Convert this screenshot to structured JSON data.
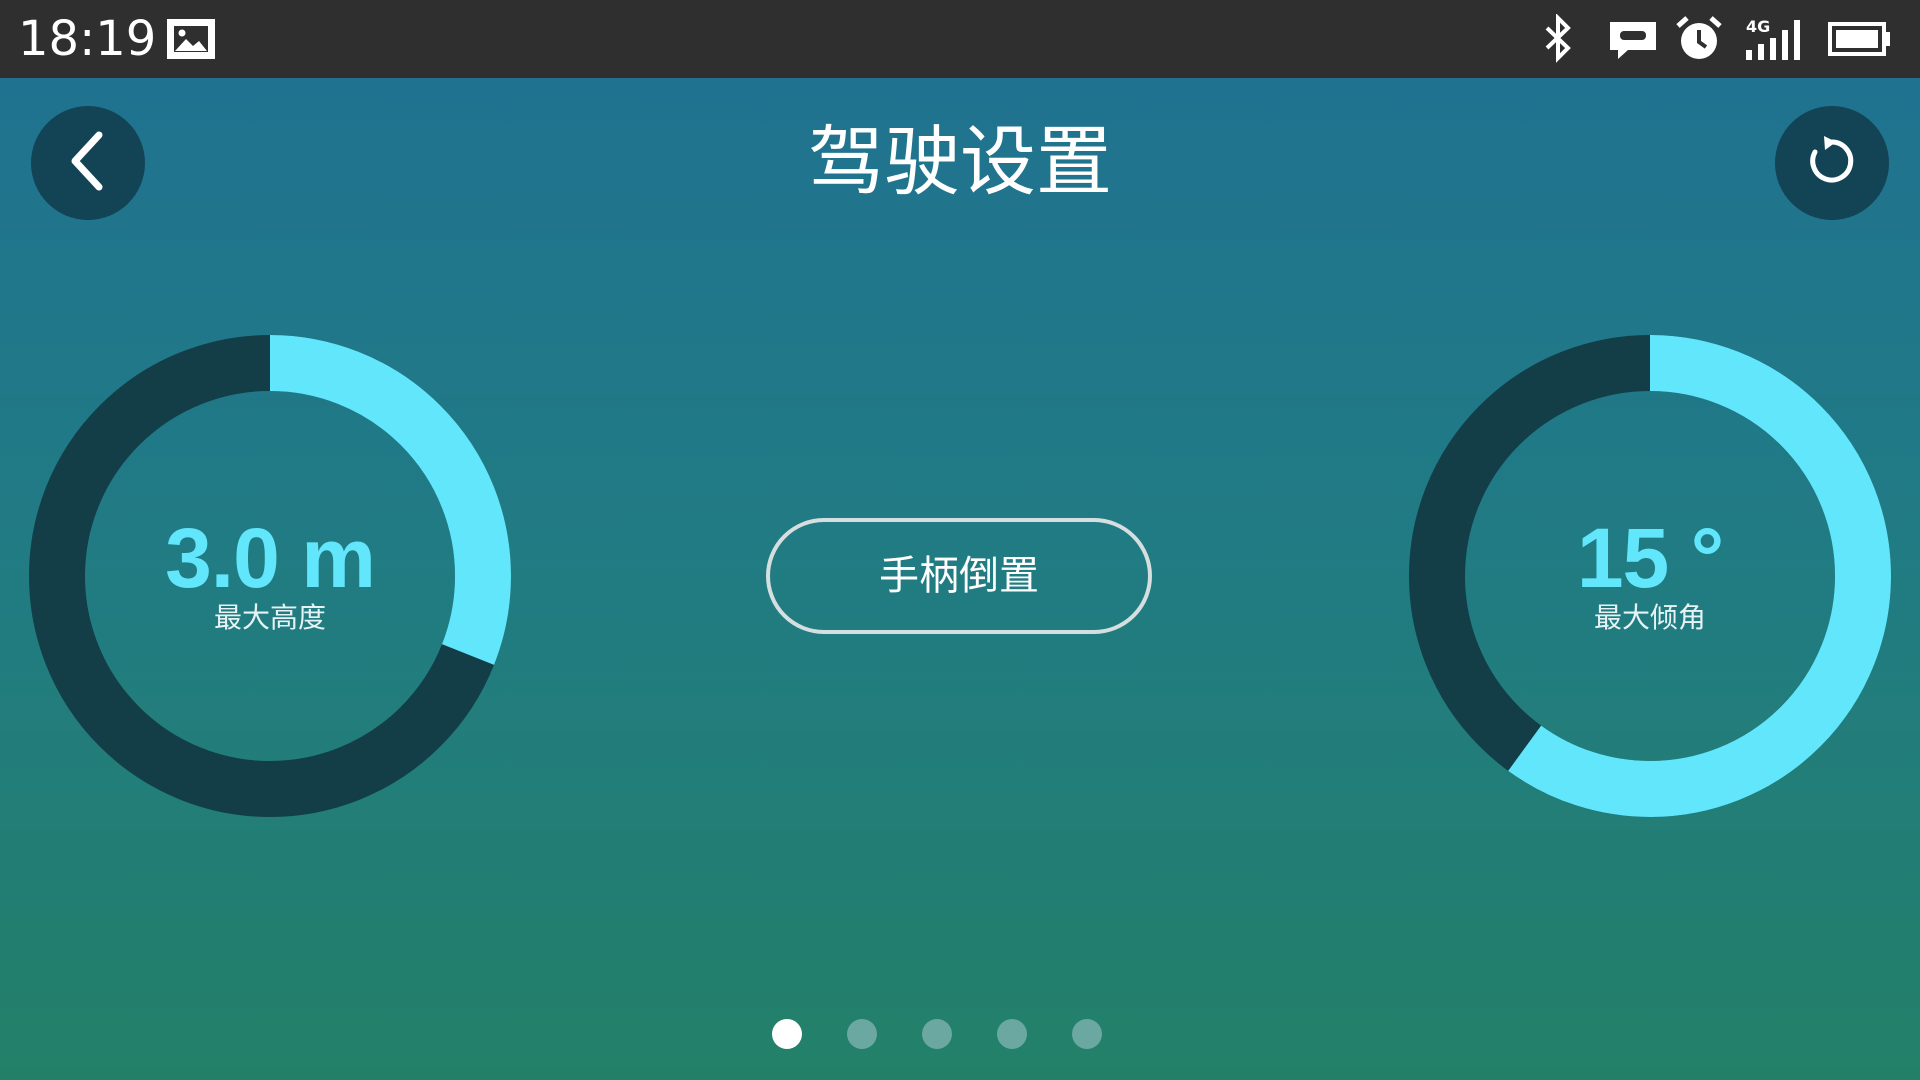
{
  "status_bar": {
    "time": "18:19",
    "icons": [
      "image-icon",
      "bluetooth-icon",
      "message-icon",
      "alarm-icon",
      "signal-4g-icon",
      "battery-icon"
    ],
    "signal_label": "4G"
  },
  "header": {
    "title": "驾驶设置",
    "back_icon": "chevron-left-icon",
    "reset_icon": "reset-icon"
  },
  "gauges": {
    "max_height": {
      "value_text": "3.0 m",
      "label": "最大高度",
      "fill_fraction": 0.31
    },
    "max_tilt": {
      "value_text": "15 °",
      "label": "最大倾角",
      "fill_fraction": 0.6
    }
  },
  "controls": {
    "invert_joystick_label": "手柄倒置"
  },
  "pager": {
    "count": 5,
    "active_index": 0
  },
  "colors": {
    "statusbar": "#2f2f2f",
    "gradient_top": "#1f7192",
    "gradient_bottom": "#238068",
    "gauge_fill": "#62e6fb",
    "gauge_track": "#133e48",
    "button_dark": "#124455",
    "dot_active": "#ffffff",
    "dot_inactive": "#6aa8a1"
  }
}
